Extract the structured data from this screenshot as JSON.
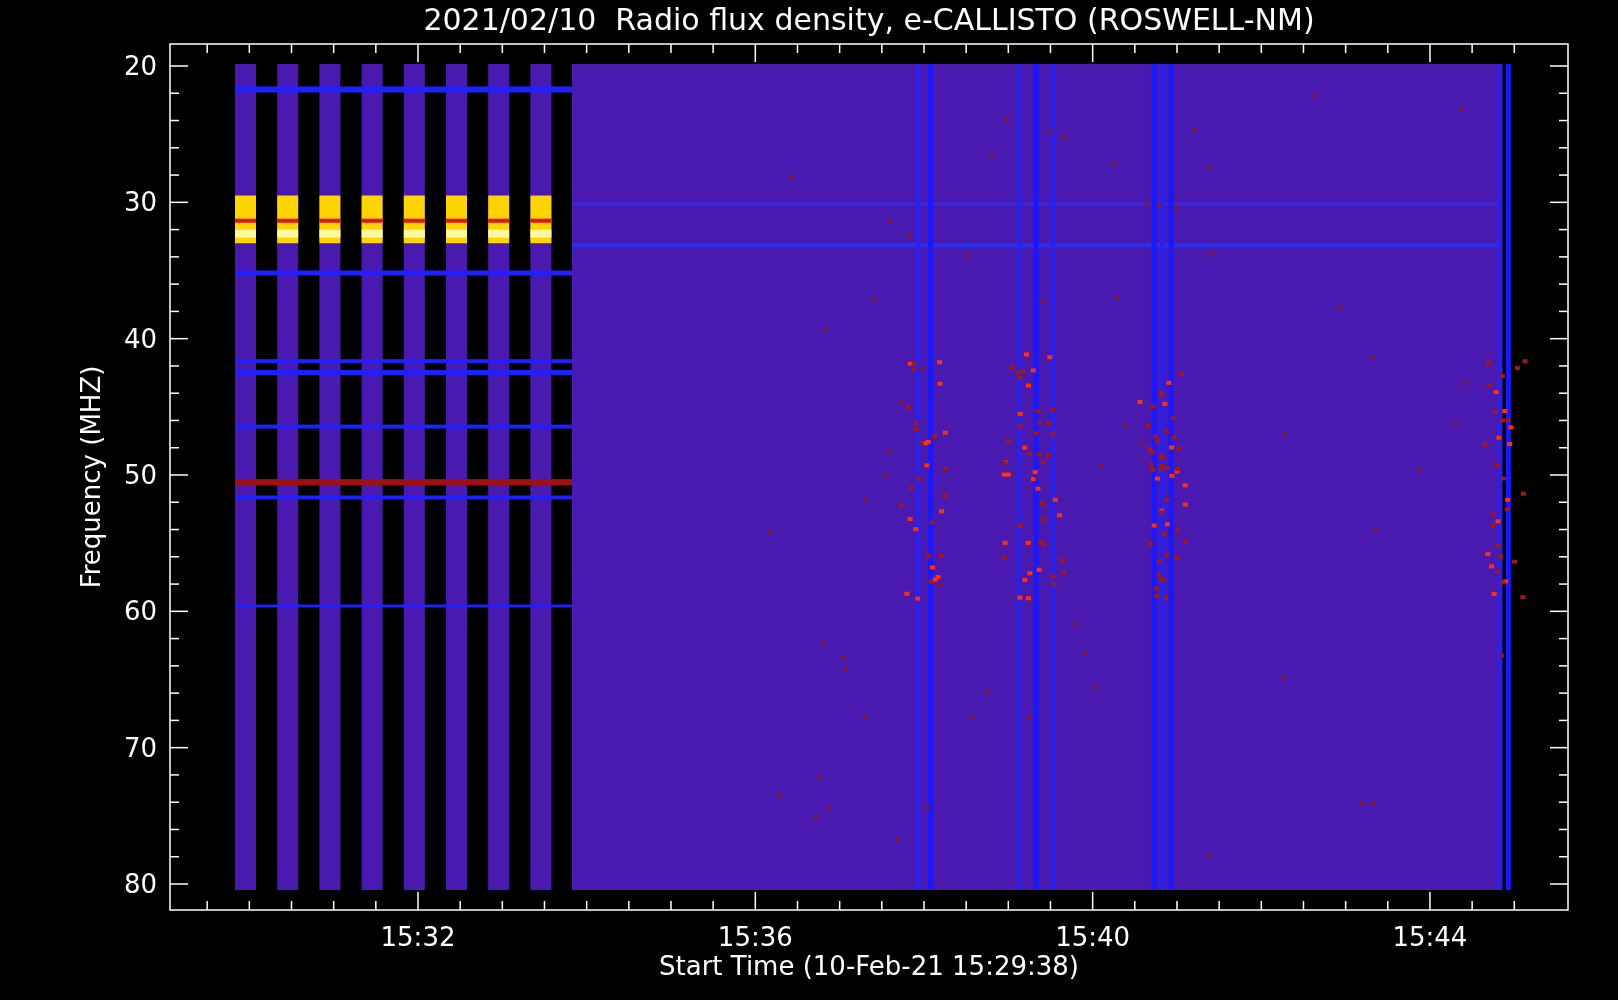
{
  "title": "2021/02/10  Radio flux density, e-CALLISTO (ROSWELL-NM)",
  "y_axis": {
    "label": "Frequency (MHZ)",
    "ticks": [
      "20",
      "30",
      "40",
      "50",
      "60",
      "70",
      "80"
    ]
  },
  "x_axis": {
    "label": "Start Time (10-Feb-21 15:29:38)",
    "ticks": [
      "15:32",
      "15:36",
      "15:40",
      "15:44"
    ]
  }
}
